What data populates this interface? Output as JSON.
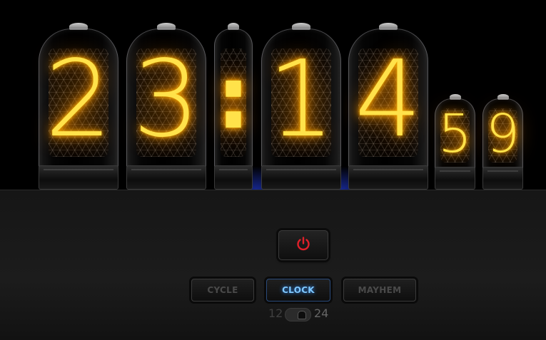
{
  "clock": {
    "hour_tens": "2",
    "hour_ones": "3",
    "separator": ":",
    "minute_tens": "1",
    "minute_ones": "4",
    "second_tens": "5",
    "second_ones": "9"
  },
  "controls": {
    "power_icon": "power-icon",
    "cycle_label": "CYCLE",
    "clock_label": "CLOCK",
    "mayhem_label": "MAYHEM",
    "active_mode": "CLOCK",
    "format_12_label": "12",
    "format_24_label": "24",
    "selected_format": "24"
  },
  "colors": {
    "digit_glow": "#ffe24a",
    "power_icon": "#e0202a",
    "active_mode": "#7fc8ff"
  }
}
